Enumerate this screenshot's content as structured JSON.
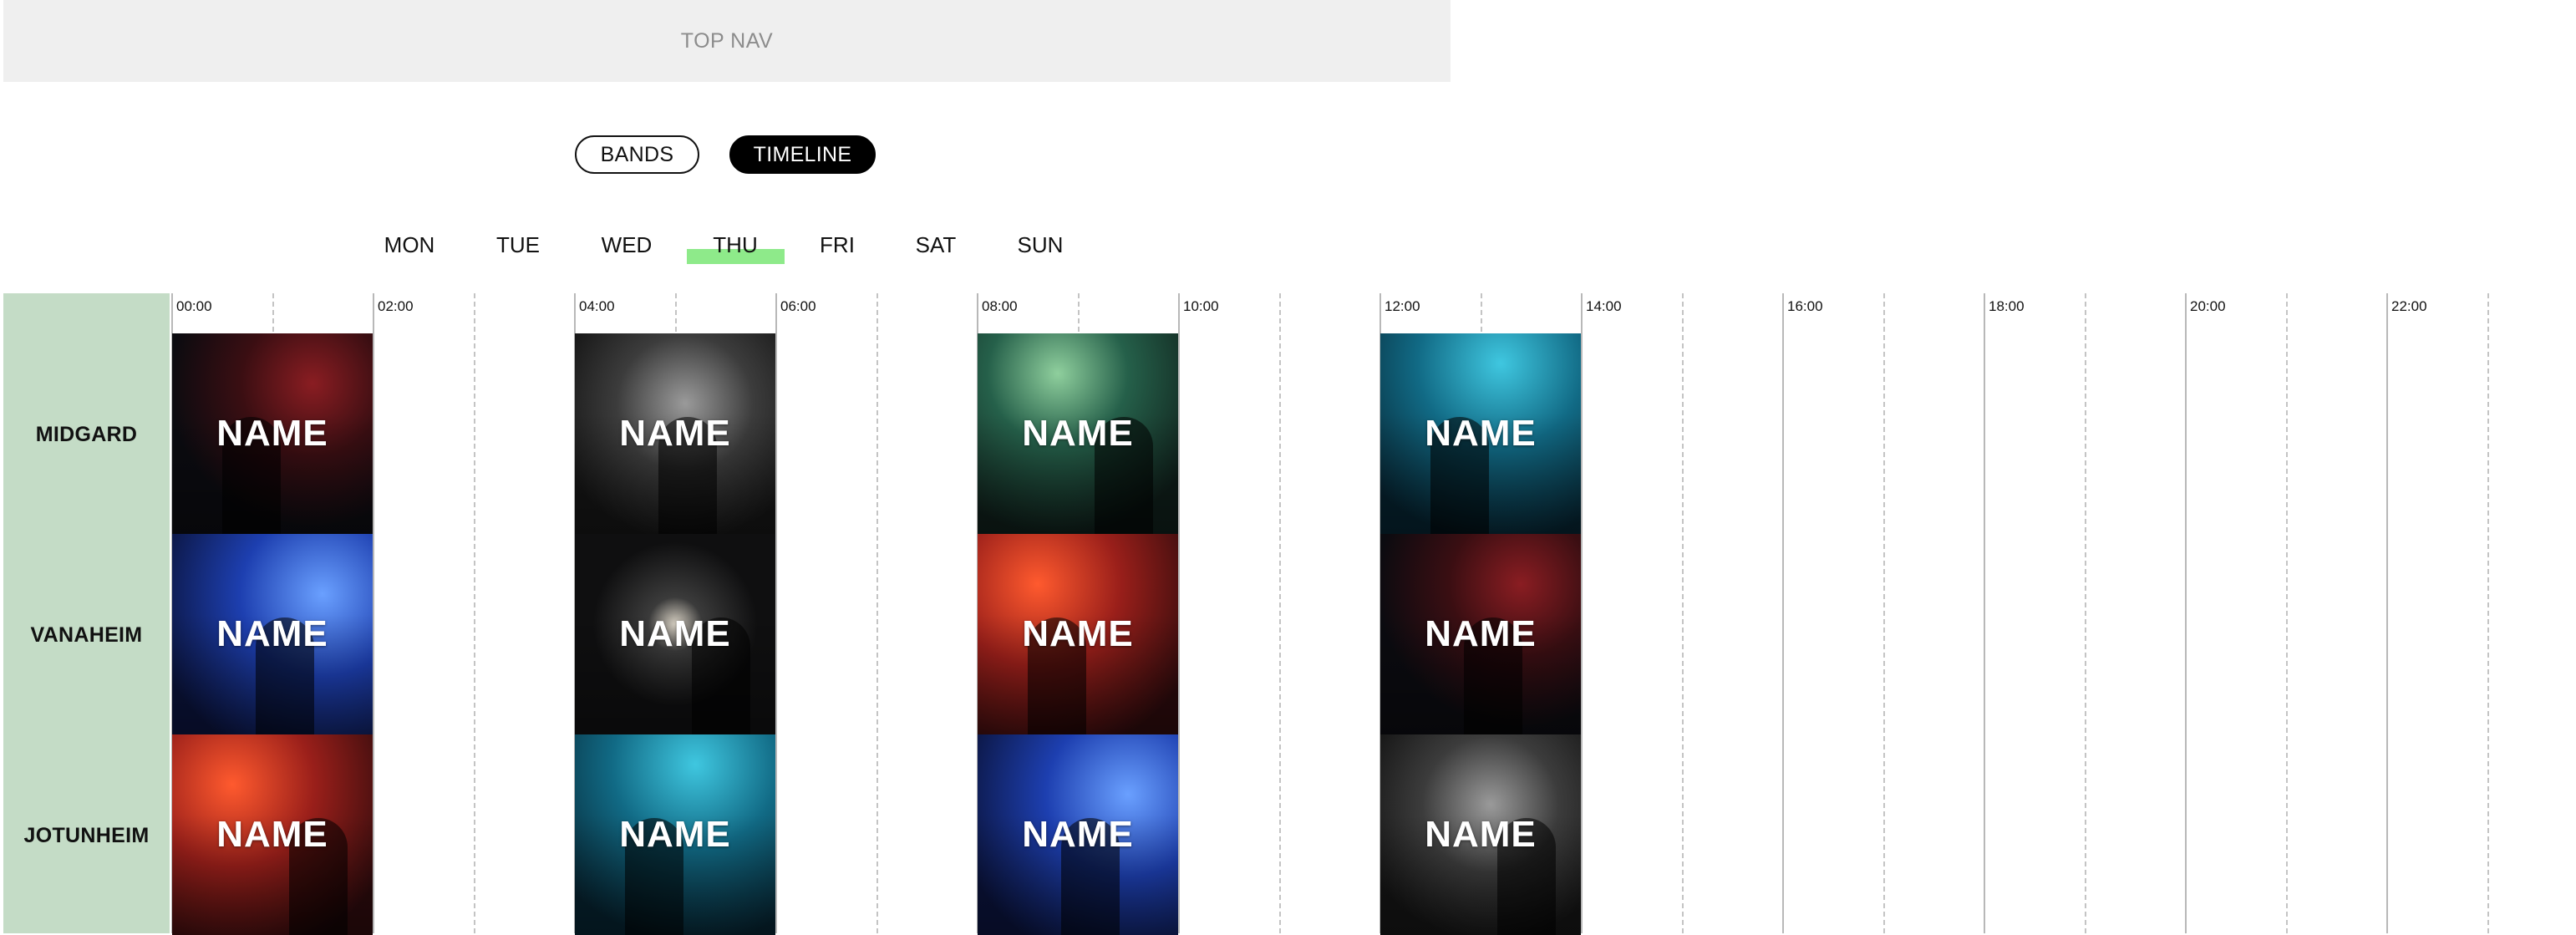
{
  "topnav": {
    "label": "TOP NAV"
  },
  "view_toggle": {
    "bands_label": "BANDS",
    "timeline_label": "TIMELINE",
    "active": "TIMELINE"
  },
  "days": {
    "items": [
      "MON",
      "TUE",
      "WED",
      "THU",
      "FRI",
      "SAT",
      "SUN"
    ],
    "active": "THU",
    "active_color": "#8eea8a"
  },
  "stages": {
    "items": [
      "MIDGARD",
      "VANAHEIM",
      "JOTUNHEIM"
    ],
    "color": "#c4dcc6"
  },
  "hours": [
    "00:00",
    "02:00",
    "04:00",
    "06:00",
    "08:00",
    "10:00",
    "12:00",
    "14:00",
    "16:00",
    "18:00",
    "20:00",
    "22:00"
  ],
  "band_tile_label": "NAME",
  "tiles": [
    {
      "stage": "MIDGARD",
      "start": "00:00",
      "end": "02:00",
      "label": "NAME",
      "theme": "dark-red"
    },
    {
      "stage": "MIDGARD",
      "start": "04:00",
      "end": "06:00",
      "label": "NAME",
      "theme": "mono"
    },
    {
      "stage": "MIDGARD",
      "start": "08:00",
      "end": "10:00",
      "label": "NAME",
      "theme": "green"
    },
    {
      "stage": "MIDGARD",
      "start": "12:00",
      "end": "14:00",
      "label": "NAME",
      "theme": "teal"
    },
    {
      "stage": "VANAHEIM",
      "start": "00:00",
      "end": "02:00",
      "label": "NAME",
      "theme": "blue"
    },
    {
      "stage": "VANAHEIM",
      "start": "04:00",
      "end": "06:00",
      "label": "NAME",
      "theme": "black"
    },
    {
      "stage": "VANAHEIM",
      "start": "08:00",
      "end": "10:00",
      "label": "NAME",
      "theme": "red"
    },
    {
      "stage": "VANAHEIM",
      "start": "12:00",
      "end": "14:00",
      "label": "NAME",
      "theme": "dark-red"
    },
    {
      "stage": "JOTUNHEIM",
      "start": "00:00",
      "end": "02:00",
      "label": "NAME",
      "theme": "red"
    },
    {
      "stage": "JOTUNHEIM",
      "start": "04:00",
      "end": "06:00",
      "label": "NAME",
      "theme": "teal"
    },
    {
      "stage": "JOTUNHEIM",
      "start": "08:00",
      "end": "10:00",
      "label": "NAME",
      "theme": "blue"
    },
    {
      "stage": "JOTUNHEIM",
      "start": "12:00",
      "end": "14:00",
      "label": "NAME",
      "theme": "mono"
    }
  ]
}
